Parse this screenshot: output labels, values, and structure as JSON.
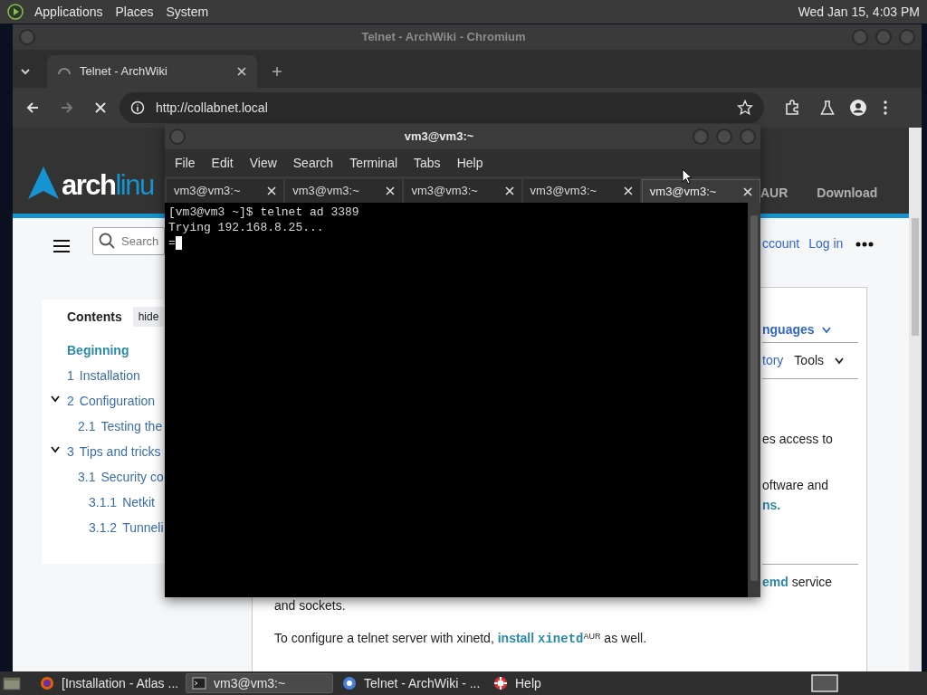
{
  "top_panel": {
    "menus": [
      "Applications",
      "Places",
      "System"
    ],
    "clock": "Wed Jan 15, 4:03 PM"
  },
  "browser": {
    "title": "Telnet - ArchWiki - Chromium",
    "tabs": [
      {
        "label": "Telnet - ArchWiki",
        "selected": true
      }
    ],
    "url": "http://collabnet.local",
    "page": {
      "logo": [
        "arch",
        "linu"
      ],
      "nav": [
        "AUR",
        "Download"
      ],
      "search_placeholder": "Search",
      "user_links": [
        "ccount",
        "Log in"
      ],
      "contents": {
        "title": "Contents",
        "hide": "hide",
        "items": [
          {
            "label": "Beginning",
            "selected": true
          },
          {
            "number": "1",
            "label": "Installation",
            "selected": false
          },
          {
            "number": "2",
            "label": "Configuration",
            "selected": false,
            "expanded": true,
            "children": [
              {
                "number": "2.1",
                "label": "Testing the",
                "selected": false
              }
            ]
          },
          {
            "number": "3",
            "label": "Tips and tricks",
            "selected": false,
            "expanded": true,
            "children": [
              {
                "number": "3.1",
                "label": "Security co",
                "selected": false,
                "children": [
                  {
                    "number": "3.1.1",
                    "label": "Netkit",
                    "selected": false
                  },
                  {
                    "number": "3.1.2",
                    "label": "Tunneli",
                    "selected": false
                  }
                ]
              }
            ]
          }
        ]
      },
      "languages": "nguages",
      "history": "tory",
      "tools": "Tools",
      "fragments": [
        {
          "kind": "text",
          "text": "es access to"
        },
        {
          "kind": "text",
          "text": "oftware and"
        },
        {
          "kind": "link",
          "text": "ns."
        }
      ],
      "service_line": {
        "link": "emd",
        "text": "service"
      },
      "paragraphs": [
        "and sockets."
      ],
      "install_line": {
        "before": "To configure a telnet server with xinetd,",
        "link": "install",
        "code": "xinetd",
        "sup": "AUR",
        "after": "as well."
      }
    }
  },
  "terminal": {
    "title": "vm3@vm3:~",
    "menus": [
      "File",
      "Edit",
      "View",
      "Search",
      "Terminal",
      "Tabs",
      "Help"
    ],
    "tabs": [
      {
        "label": "vm3@vm3:~",
        "selected": false
      },
      {
        "label": "vm3@vm3:~",
        "selected": false
      },
      {
        "label": "vm3@vm3:~",
        "selected": false
      },
      {
        "label": "vm3@vm3:~",
        "selected": false
      },
      {
        "label": "vm3@vm3:~",
        "selected": true
      }
    ],
    "lines": [
      "[vm3@vm3 ~]$ telnet ad 3389",
      "Trying 192.168.8.25...",
      "="
    ]
  },
  "taskbar": [
    {
      "kind": "firefox",
      "label": "[Installation - Atlas ...",
      "selected": false
    },
    {
      "kind": "terminal",
      "label": "vm3@vm3:~",
      "selected": true
    },
    {
      "kind": "chromium",
      "label": "Telnet - ArchWiki - ...",
      "selected": false
    },
    {
      "kind": "help",
      "label": "Help",
      "selected": false
    }
  ]
}
